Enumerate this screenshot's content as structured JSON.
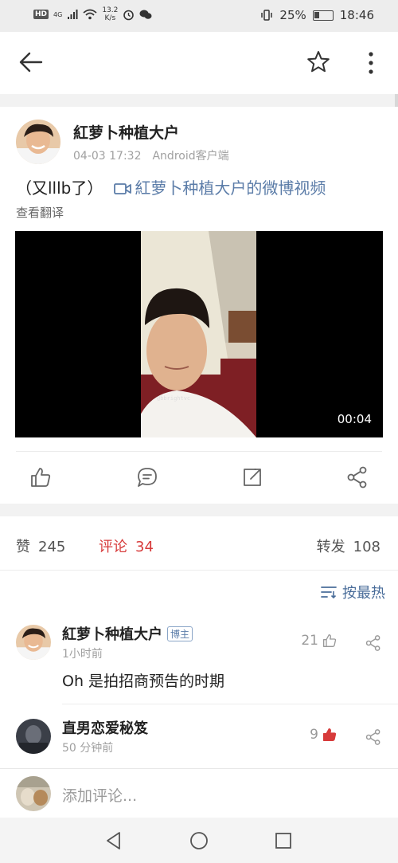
{
  "status_bar": {
    "network": "4G",
    "speed_value": "13.2",
    "speed_unit": "K/s",
    "battery": "25%",
    "time": "18:46"
  },
  "post": {
    "author": "紅萝卜种植大户",
    "time": "04-03 17:32",
    "source": "Android客户端",
    "text": "（又lllb了）",
    "link_text": "紅萝卜种植大户的微博视频",
    "translate": "查看翻译",
    "video": {
      "duration": "00:04",
      "watermark": "@bbrightvc"
    }
  },
  "stats": {
    "likes_label": "赞",
    "likes": "245",
    "comments_label": "评论",
    "comments": "34",
    "reposts_label": "转发",
    "reposts": "108"
  },
  "sort": {
    "label": "按最热"
  },
  "comments": [
    {
      "name": "紅萝卜种植大户",
      "badge": "博主",
      "time": "1小时前",
      "text": "Oh 是拍招商预告的时期",
      "likes": "21"
    },
    {
      "name": "直男恋爱秘笈",
      "time": "50 分钟前",
      "likes": "9"
    }
  ],
  "input": {
    "placeholder": "添加评论..."
  },
  "colors": {
    "link": "#5b7ca8",
    "accent_red": "#d73b3b",
    "muted": "#a0a0a0",
    "divider_band": "#f2f2f2"
  },
  "icons": [
    "back-arrow-icon",
    "star-icon",
    "more-vertical-icon",
    "video-camera-icon",
    "like-icon",
    "comment-icon",
    "repost-icon",
    "share-icon",
    "sort-icon",
    "back-triangle-icon",
    "home-circle-icon",
    "recents-square-icon"
  ]
}
